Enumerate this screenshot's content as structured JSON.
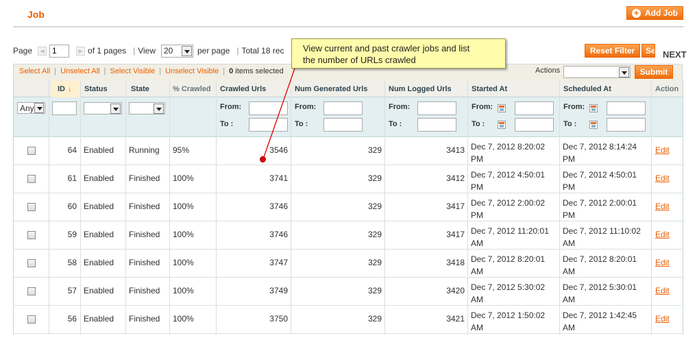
{
  "header": {
    "title": "Job",
    "add_button": "Add Job"
  },
  "pager": {
    "page_label": "Page",
    "page_value": "1",
    "of_pages": "of 1 pages",
    "view_label": "View",
    "view_value": "20",
    "per_page": "per page",
    "total": "Total 18 rec",
    "reset_filter": "Reset Filter",
    "search_button": "Se",
    "next_label": "NEXT"
  },
  "massaction": {
    "select_all": "Select All",
    "unselect_all": "Unselect All",
    "select_visible": "Select Visible",
    "unselect_visible": "Unselect Visible",
    "selected_count": "0",
    "selected_suffix": "items selected",
    "actions_label": "Actions",
    "submit": "Submit"
  },
  "grid": {
    "columns": {
      "id": "ID",
      "status": "Status",
      "state": "State",
      "crawled": "% Crawled",
      "crawled_urls": "Crawled Urls",
      "generated_urls": "Num Generated Urls",
      "logged_urls": "Num Logged Urls",
      "started_at": "Started At",
      "scheduled_at": "Scheduled At",
      "action": "Action"
    },
    "filter": {
      "any": "Any",
      "from": "From:",
      "to": "To :"
    },
    "rows": [
      {
        "id": "64",
        "status": "Enabled",
        "state": "Running",
        "pct": "95%",
        "crawled": "3546",
        "generated": "329",
        "logged": "3413",
        "started_l1": "Dec 7, 2012 8:20:02",
        "started_l2": "PM",
        "sched_l1": "Dec 7, 2012 8:14:24",
        "sched_l2": "PM",
        "action": "Edit"
      },
      {
        "id": "61",
        "status": "Enabled",
        "state": "Finished",
        "pct": "100%",
        "crawled": "3741",
        "generated": "329",
        "logged": "3412",
        "started_l1": "Dec 7, 2012 4:50:01",
        "started_l2": "PM",
        "sched_l1": "Dec 7, 2012 4:50:01",
        "sched_l2": "PM",
        "action": "Edit"
      },
      {
        "id": "60",
        "status": "Enabled",
        "state": "Finished",
        "pct": "100%",
        "crawled": "3746",
        "generated": "329",
        "logged": "3417",
        "started_l1": "Dec 7, 2012 2:00:02",
        "started_l2": "PM",
        "sched_l1": "Dec 7, 2012 2:00:01",
        "sched_l2": "PM",
        "action": "Edit"
      },
      {
        "id": "59",
        "status": "Enabled",
        "state": "Finished",
        "pct": "100%",
        "crawled": "3746",
        "generated": "329",
        "logged": "3417",
        "started_l1": "Dec 7, 2012 11:20:01",
        "started_l2": "AM",
        "sched_l1": "Dec 7, 2012 11:10:02",
        "sched_l2": "AM",
        "action": "Edit"
      },
      {
        "id": "58",
        "status": "Enabled",
        "state": "Finished",
        "pct": "100%",
        "crawled": "3747",
        "generated": "329",
        "logged": "3418",
        "started_l1": "Dec 7, 2012 8:20:01",
        "started_l2": "AM",
        "sched_l1": "Dec 7, 2012 8:20:01",
        "sched_l2": "AM",
        "action": "Edit"
      },
      {
        "id": "57",
        "status": "Enabled",
        "state": "Finished",
        "pct": "100%",
        "crawled": "3749",
        "generated": "329",
        "logged": "3420",
        "started_l1": "Dec 7, 2012 5:30:02",
        "started_l2": "AM",
        "sched_l1": "Dec 7, 2012 5:30:01",
        "sched_l2": "AM",
        "action": "Edit"
      },
      {
        "id": "56",
        "status": "Enabled",
        "state": "Finished",
        "pct": "100%",
        "crawled": "3750",
        "generated": "329",
        "logged": "3421",
        "started_l1": "Dec 7, 2012 1:50:02",
        "started_l2": "AM",
        "sched_l1": "Dec 7, 2012 1:42:45",
        "sched_l2": "AM",
        "action": "Edit"
      }
    ]
  },
  "callout": {
    "line1": "View current and past crawler jobs and list",
    "line2": "the number of URLs crawled"
  },
  "colors": {
    "accent": "#eb5e00",
    "button": "#f77c16",
    "callout_bg": "#fffcab",
    "filter_bg": "#e3eff1"
  },
  "icons": [
    "plus-circle-icon",
    "prev-arrow-icon",
    "next-arrow-icon",
    "sort-down-icon",
    "calendar-icon",
    "chevron-down-icon"
  ]
}
